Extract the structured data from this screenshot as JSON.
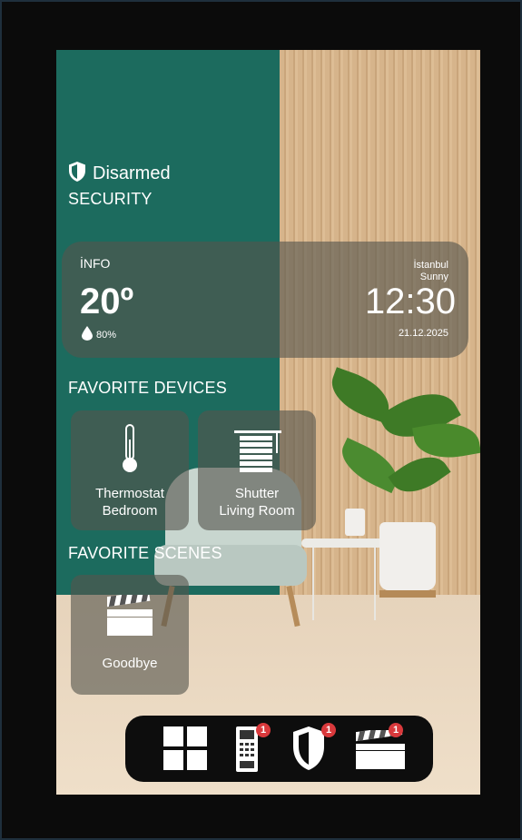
{
  "security": {
    "status": "Disarmed",
    "title": "SECURITY"
  },
  "info": {
    "label": "İNFO",
    "temperature": "20º",
    "humidity": "80%",
    "city": "İstanbul",
    "weather": "Sunny",
    "time": "12:30",
    "date": "21.12.2025"
  },
  "favorite_devices": {
    "title": "FAVORITE DEVICES",
    "items": [
      {
        "line1": "Thermostat",
        "line2": "Bedroom",
        "icon": "thermometer-icon"
      },
      {
        "line1": "Shutter",
        "line2": "Living Room",
        "icon": "shutter-icon"
      }
    ]
  },
  "favorite_scenes": {
    "title": "FAVORITE SCENES",
    "items": [
      {
        "label": "Goodbye",
        "icon": "clapperboard-icon"
      }
    ]
  },
  "dock": {
    "items": [
      {
        "icon": "grid-icon",
        "badge": ""
      },
      {
        "icon": "intercom-icon",
        "badge": "1"
      },
      {
        "icon": "shield-icon",
        "badge": "1"
      },
      {
        "icon": "clapperboard-icon",
        "badge": "1"
      }
    ]
  },
  "colors": {
    "accent_green": "#1c6b5e",
    "badge_red": "#d9393c",
    "card_bg": "rgba(85,85,78,0.62)"
  }
}
